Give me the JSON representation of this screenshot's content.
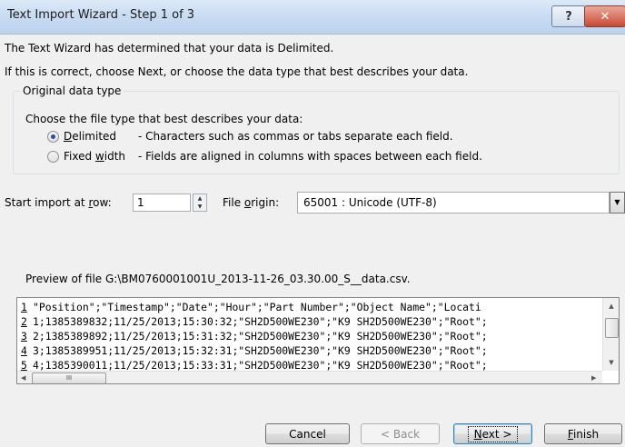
{
  "window": {
    "title": "Text Import Wizard - Step 1 of 3",
    "help": "?",
    "close": "✕"
  },
  "intro": {
    "line1": "The Text Wizard has determined that your data is Delimited.",
    "line2": "If this is correct, choose Next, or choose the data type that best describes your data."
  },
  "group": {
    "label": "Original data type",
    "prompt": "Choose the file type that best describes your data:",
    "options": [
      {
        "pre": "",
        "key": "D",
        "post": "elimited",
        "desc": "- Characters such as commas or tabs separate each field.",
        "checked": true
      },
      {
        "pre": "Fixed ",
        "key": "w",
        "post": "idth",
        "desc": "- Fields are aligned in columns with spaces between each field.",
        "checked": false
      }
    ]
  },
  "start_row": {
    "pre": "Start import at ",
    "key": "r",
    "post": "ow:",
    "value": "1"
  },
  "file_origin": {
    "pre": "File ",
    "key": "o",
    "post": "rigin:",
    "value": "65001 : Unicode (UTF-8)"
  },
  "preview": {
    "label": "Preview of file G:\\BM0760001001U_2013-11-26_03.30.00_S__data.csv.",
    "lines": [
      {
        "n": "1",
        "text": "\"Position\";\"Timestamp\";\"Date\";\"Hour\";\"Part Number\";\"Object Name\";\"Locati"
      },
      {
        "n": "2",
        "text": "1;1385389832;11/25/2013;15:30:32;\"SH2D500WE230\";\"K9 SH2D500WE230\";\"Root\";"
      },
      {
        "n": "3",
        "text": "2;1385389892;11/25/2013;15:31:32;\"SH2D500WE230\";\"K9 SH2D500WE230\";\"Root\";"
      },
      {
        "n": "4",
        "text": "3;1385389951;11/25/2013;15:32:31;\"SH2D500WE230\";\"K9 SH2D500WE230\";\"Root\";"
      },
      {
        "n": "5",
        "text": "4;1385390011;11/25/2013;15:33:31;\"SH2D500WE230\";\"K9 SH2D500WE230\";\"Root\";"
      }
    ],
    "hthumb": "III"
  },
  "buttons": {
    "cancel": "Cancel",
    "back": "< Back",
    "next": {
      "key": "N",
      "post": "ext >"
    },
    "finish": {
      "key": "F",
      "post": "inish"
    }
  }
}
